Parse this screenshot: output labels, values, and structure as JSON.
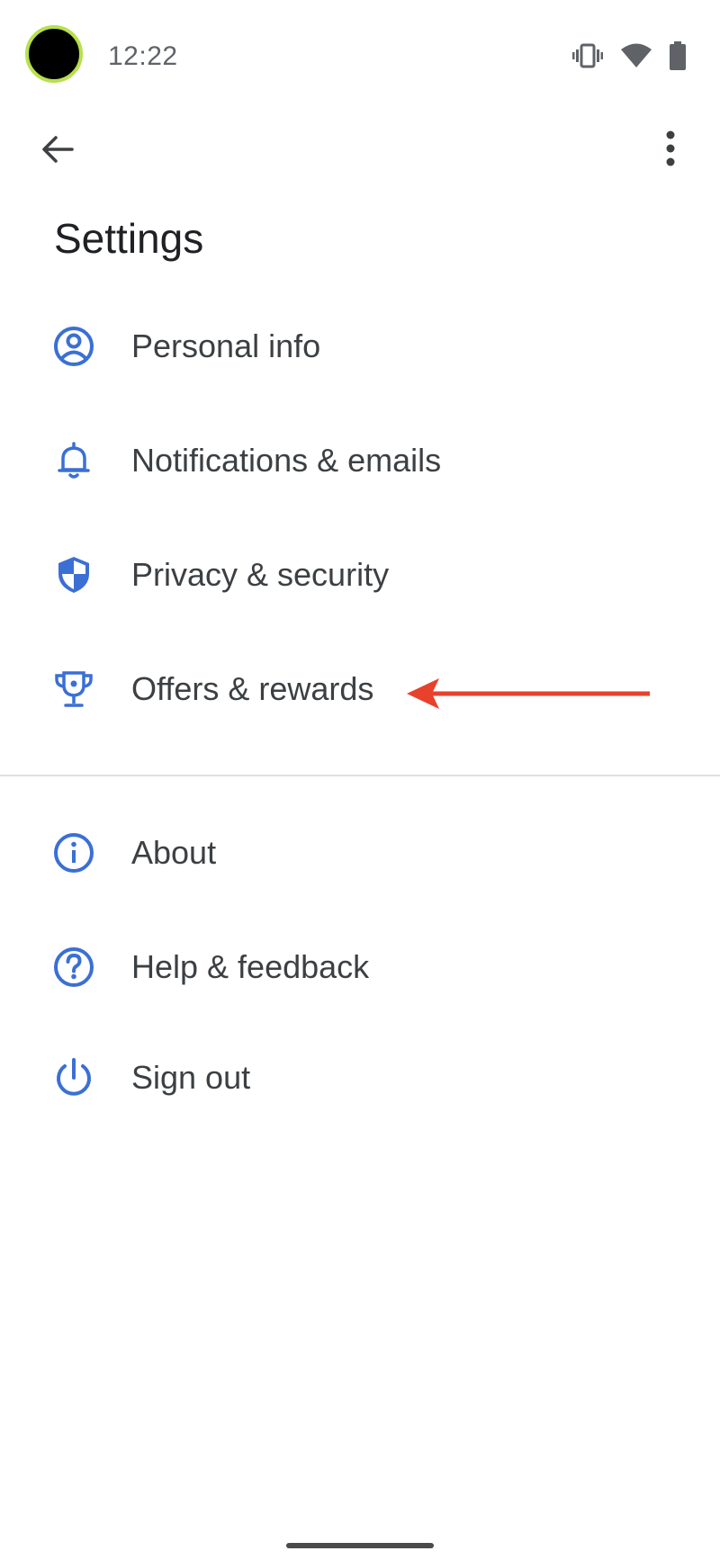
{
  "status_bar": {
    "time": "12:22",
    "icons": [
      "vibrate-icon",
      "wifi-icon",
      "battery-icon"
    ]
  },
  "app_bar": {
    "back_icon": "arrow-back-icon",
    "more_icon": "more-vert-icon"
  },
  "page": {
    "title": "Settings"
  },
  "menu": {
    "items": [
      {
        "label": "Personal info",
        "icon": "account-circle-icon"
      },
      {
        "label": "Notifications & emails",
        "icon": "bell-icon"
      },
      {
        "label": "Privacy & security",
        "icon": "shield-icon"
      },
      {
        "label": "Offers & rewards",
        "icon": "trophy-icon"
      },
      {
        "label": "About",
        "icon": "info-icon"
      },
      {
        "label": "Help & feedback",
        "icon": "help-icon"
      },
      {
        "label": "Sign out",
        "icon": "power-icon"
      }
    ]
  },
  "colors": {
    "accent": "#3b6fd4",
    "annotation": "#e8412c",
    "text": "#3c4043"
  }
}
